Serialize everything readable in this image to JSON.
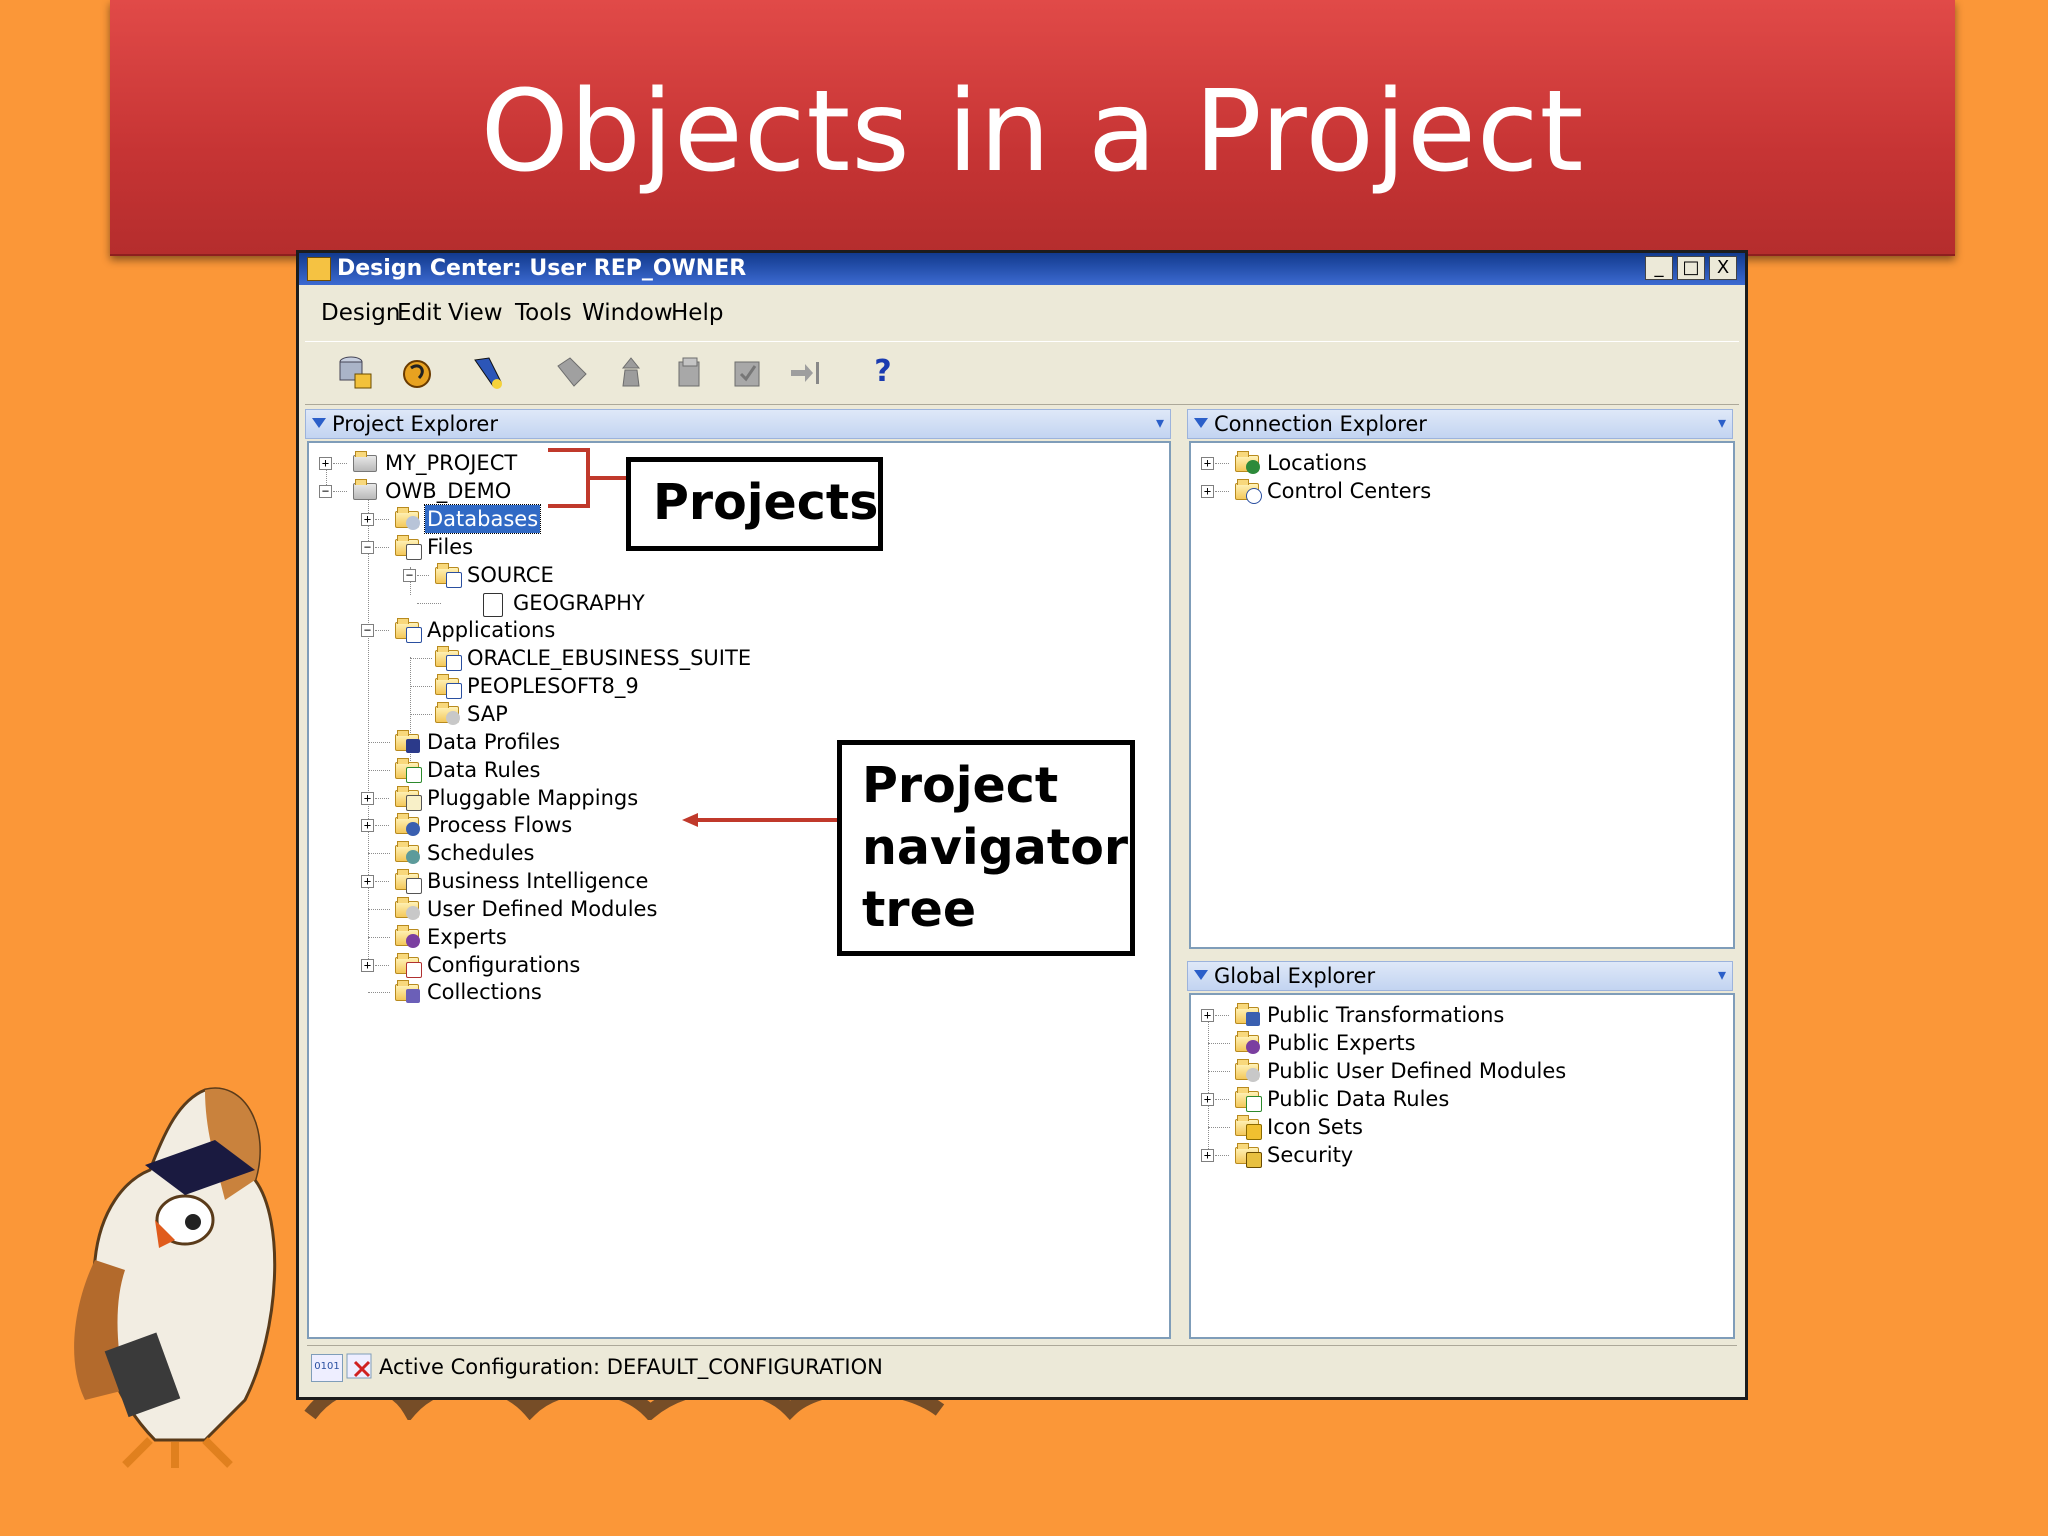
{
  "banner": {
    "title": "Objects in a Project"
  },
  "window": {
    "title": "Design Center: User REP_OWNER",
    "buttons": {
      "minimize": "_",
      "maximize": "□",
      "close": "X"
    }
  },
  "menubar": {
    "items": [
      {
        "label": "Design"
      },
      {
        "label": "Edit"
      },
      {
        "label": "View"
      },
      {
        "label": "Tools"
      },
      {
        "label": "Window"
      },
      {
        "label": "Help"
      }
    ]
  },
  "toolbar": {
    "icons": [
      "database-save-icon",
      "undo-icon",
      "flashlight-icon",
      "tag-icon",
      "deploy-icon",
      "clipboard-icon",
      "validate-icon",
      "arrow-icon",
      "help-icon"
    ],
    "help_label": "?"
  },
  "project_explorer": {
    "title": "Project Explorer",
    "nodes": [
      {
        "label": "MY_PROJECT"
      },
      {
        "label": "OWB_DEMO"
      },
      {
        "label": "Databases"
      },
      {
        "label": "Files"
      },
      {
        "label": "SOURCE"
      },
      {
        "label": "GEOGRAPHY"
      },
      {
        "label": "Applications"
      },
      {
        "label": "ORACLE_EBUSINESS_SUITE"
      },
      {
        "label": "PEOPLESOFT8_9"
      },
      {
        "label": "SAP"
      },
      {
        "label": "Data Profiles"
      },
      {
        "label": "Data Rules"
      },
      {
        "label": "Pluggable Mappings"
      },
      {
        "label": "Process Flows"
      },
      {
        "label": "Schedules"
      },
      {
        "label": "Business Intelligence"
      },
      {
        "label": "User Defined Modules"
      },
      {
        "label": "Experts"
      },
      {
        "label": "Configurations"
      },
      {
        "label": "Collections"
      }
    ]
  },
  "connection_explorer": {
    "title": "Connection Explorer",
    "nodes": [
      {
        "label": "Locations"
      },
      {
        "label": "Control Centers"
      }
    ]
  },
  "global_explorer": {
    "title": "Global Explorer",
    "nodes": [
      {
        "label": "Public Transformations"
      },
      {
        "label": "Public Experts"
      },
      {
        "label": "Public User Defined Modules"
      },
      {
        "label": "Public Data Rules"
      },
      {
        "label": "Icon Sets"
      },
      {
        "label": "Security"
      }
    ]
  },
  "status": {
    "text": "Active Configuration: DEFAULT_CONFIGURATION"
  },
  "callouts": {
    "projects": "Projects",
    "tree_line1": "Project",
    "tree_line2": "navigator",
    "tree_line3": "tree"
  },
  "colors": {
    "slide_bg": "#fb9738",
    "banner": "#d03c3c",
    "selection": "#316ac5",
    "annotation_line": "#c0392b"
  }
}
